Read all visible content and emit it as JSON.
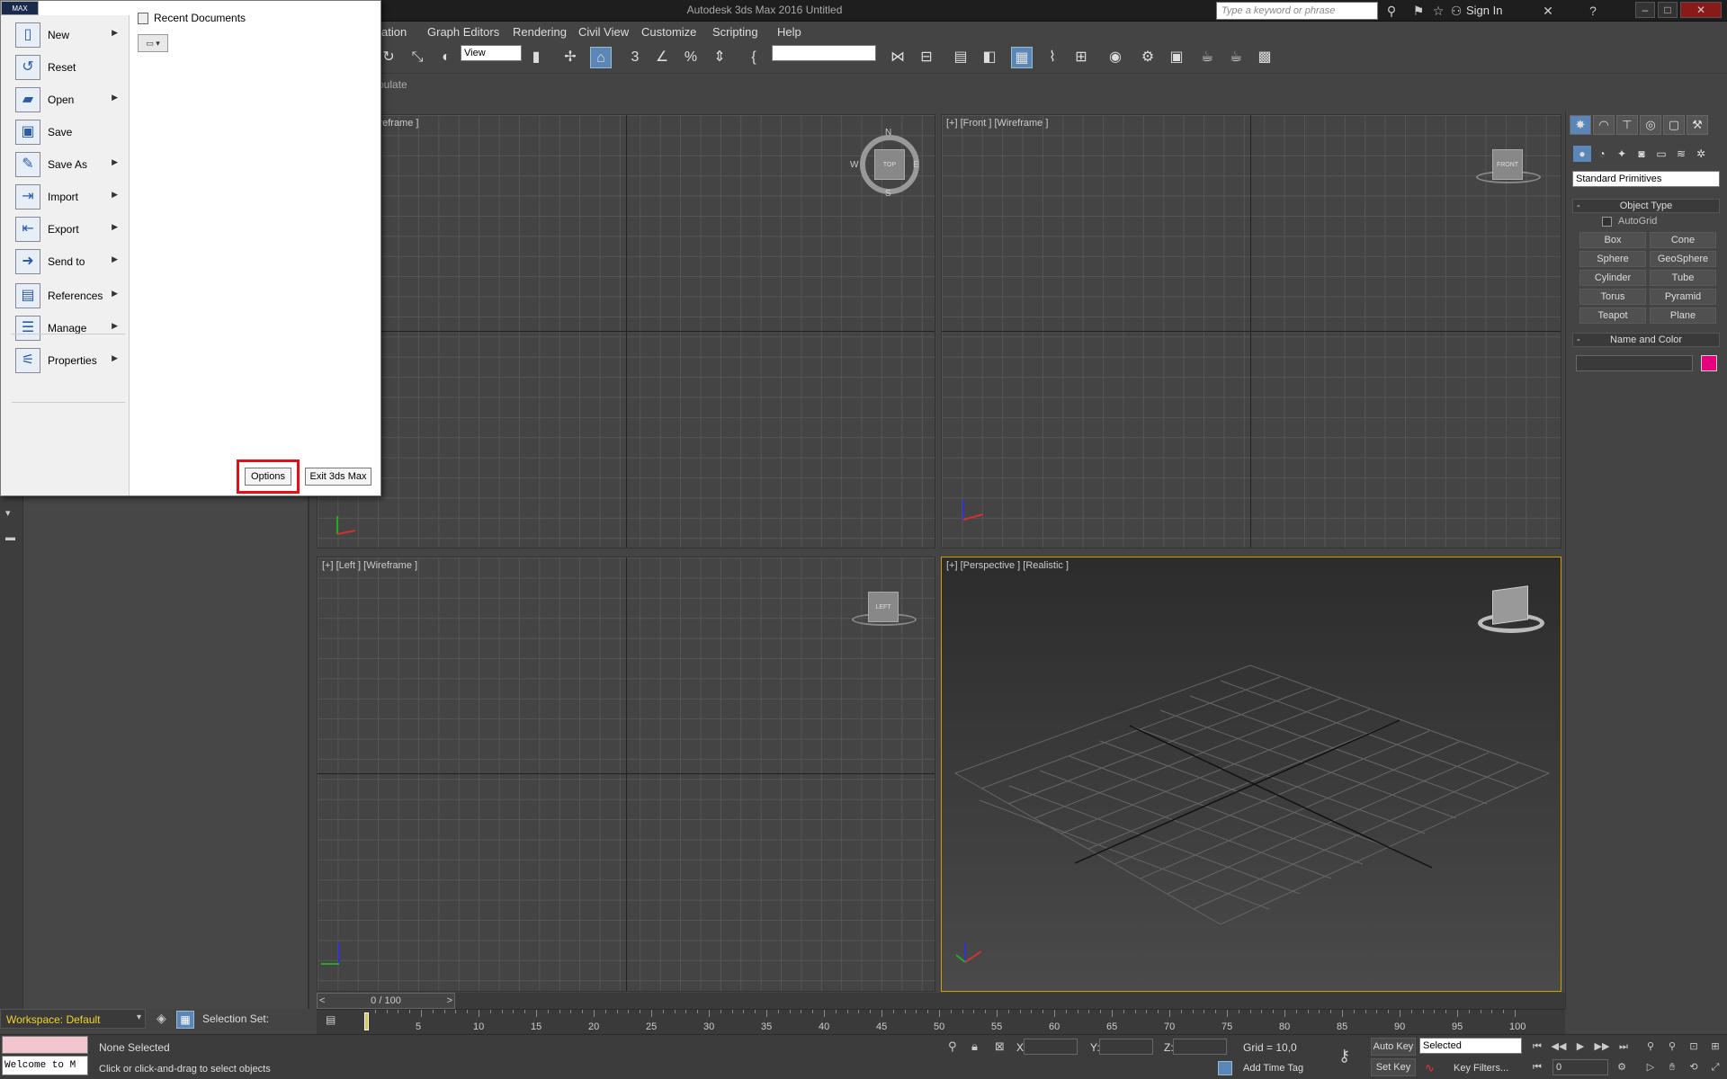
{
  "window": {
    "title": "Autodesk 3ds Max 2016    Untitled"
  },
  "search": {
    "placeholder": "Type a keyword or phrase"
  },
  "account": {
    "sign_in": "Sign In"
  },
  "menubar": [
    "ation",
    "Graph Editors",
    "Rendering",
    "Civil View",
    "Customize",
    "Scripting",
    "Help"
  ],
  "toolbar": {
    "view_select": "View",
    "ribbon_label": "pulate"
  },
  "viewports": {
    "top": {
      "label": "ireframe ]"
    },
    "front": {
      "label": "[+] [Front ] [Wireframe ]",
      "cube": "FRONT"
    },
    "left": {
      "label": "[+] [Left ] [Wireframe ]",
      "cube": "LEFT"
    },
    "perspective": {
      "label": "[+] [Perspective ] [Realistic ]"
    },
    "top_cube": "TOP",
    "compass": {
      "n": "N",
      "s": "S",
      "e": "E",
      "w": "W"
    }
  },
  "command_panel": {
    "category": "Standard Primitives",
    "object_type": {
      "title": "Object Type",
      "autogrid": "AutoGrid",
      "buttons": [
        "Box",
        "Cone",
        "Sphere",
        "GeoSphere",
        "Cylinder",
        "Tube",
        "Torus",
        "Pyramid",
        "Teapot",
        "Plane"
      ]
    },
    "name_color": {
      "title": "Name and Color",
      "color": "#e5007e"
    }
  },
  "timeline": {
    "slider": "0 / 100",
    "ticks": [
      "5",
      "10",
      "15",
      "20",
      "25",
      "30",
      "35",
      "40",
      "45",
      "50",
      "55",
      "60",
      "65",
      "70",
      "75",
      "80",
      "85",
      "90",
      "95",
      "100"
    ]
  },
  "status": {
    "workspace": "Workspace: Default",
    "selection_set": "Selection Set:",
    "listener": "Welcome to M",
    "selected": "None Selected",
    "prompt": "Click or click-and-drag to select objects",
    "x": "X:",
    "y": "Y:",
    "z": "Z:",
    "grid": "Grid = 10,0",
    "add_time_tag": "Add Time Tag",
    "auto_key": "Auto Key",
    "set_key": "Set Key",
    "selected_dropdown": "Selected",
    "key_filters": "Key Filters...",
    "frame": "0"
  },
  "app_menu": {
    "logo": "MAX",
    "items": [
      {
        "label": "New",
        "icon": "new-file-icon",
        "arrow": true
      },
      {
        "label": "Reset",
        "icon": "reset-icon",
        "arrow": false
      },
      {
        "label": "Open",
        "icon": "open-folder-icon",
        "arrow": true
      },
      {
        "label": "Save",
        "icon": "save-icon",
        "arrow": false
      },
      {
        "label": "Save As",
        "icon": "save-as-icon",
        "arrow": true
      },
      {
        "label": "Import",
        "icon": "import-icon",
        "arrow": true
      },
      {
        "label": "Export",
        "icon": "export-icon",
        "arrow": true
      },
      {
        "label": "Send to",
        "icon": "send-to-icon",
        "arrow": true
      },
      {
        "label": "References",
        "icon": "references-icon",
        "arrow": true
      },
      {
        "label": "Manage",
        "icon": "manage-icon",
        "arrow": true
      },
      {
        "label": "Properties",
        "icon": "properties-icon",
        "arrow": true
      }
    ],
    "recent_title": "Recent Documents",
    "options": "Options",
    "exit": "Exit 3ds Max"
  }
}
